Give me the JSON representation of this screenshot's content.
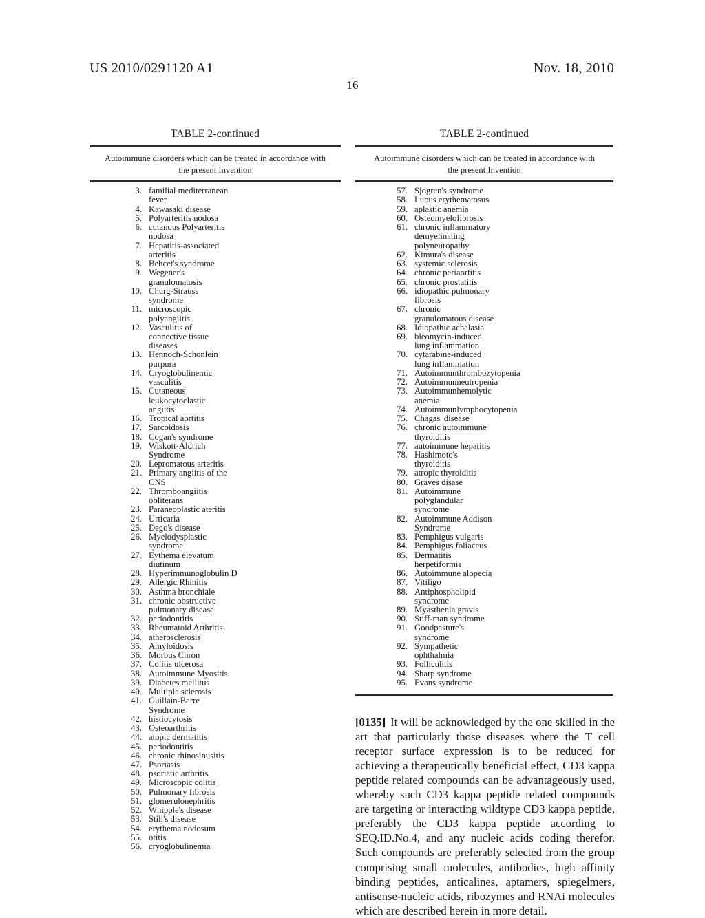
{
  "header": {
    "publication_number": "US 2010/0291120 A1",
    "publication_date": "Nov. 18, 2010",
    "page_number": "16"
  },
  "tables": {
    "left": {
      "caption": "TABLE 2-continued",
      "subhead_line1": "Autoimmune disorders which can be treated in accordance with",
      "subhead_line2": "the present Invention",
      "entries": [
        {
          "num": "3.",
          "lines": [
            "familial mediterranean",
            "fever"
          ]
        },
        {
          "num": "4.",
          "lines": [
            "Kawasaki disease"
          ]
        },
        {
          "num": "5.",
          "lines": [
            "Polyarteritis nodosa"
          ]
        },
        {
          "num": "6.",
          "lines": [
            "cutanous Polyarteritis",
            "nodosa"
          ]
        },
        {
          "num": "7.",
          "lines": [
            "Hepatitis-associated",
            "arteritis"
          ]
        },
        {
          "num": "8.",
          "lines": [
            "Behcet's syndrome"
          ]
        },
        {
          "num": "9.",
          "lines": [
            "Wegener's",
            "granulomatosis"
          ]
        },
        {
          "num": "10.",
          "lines": [
            "Churg-Strauss",
            "syndrome"
          ]
        },
        {
          "num": "11.",
          "lines": [
            "microscopic",
            "polyangiitis"
          ]
        },
        {
          "num": "12.",
          "lines": [
            "Vasculitis of",
            "connective tissue",
            "diseases"
          ]
        },
        {
          "num": "13.",
          "lines": [
            "Hennoch-Schonlein",
            "purpura"
          ]
        },
        {
          "num": "14.",
          "lines": [
            "Cryoglobulinemic",
            "vasculitis"
          ]
        },
        {
          "num": "15.",
          "lines": [
            "Cutaneous",
            "leukocytoclastic",
            "angiitis"
          ]
        },
        {
          "num": "16.",
          "lines": [
            "Tropical aortitis"
          ]
        },
        {
          "num": "17.",
          "lines": [
            "Sarcoidosis"
          ]
        },
        {
          "num": "18.",
          "lines": [
            "Cogan's syndrome"
          ]
        },
        {
          "num": "19.",
          "lines": [
            "Wiskott-Aldrich",
            "Syndrome"
          ]
        },
        {
          "num": "20.",
          "lines": [
            "Lepromatous arteritis"
          ]
        },
        {
          "num": "21.",
          "lines": [
            "Primary angiitis of the",
            "CNS"
          ]
        },
        {
          "num": "22.",
          "lines": [
            "Thromboangiitis",
            "obliterans"
          ]
        },
        {
          "num": "23.",
          "lines": [
            "Paraneoplastic ateritis"
          ]
        },
        {
          "num": "24.",
          "lines": [
            "Urticaria"
          ]
        },
        {
          "num": "25.",
          "lines": [
            "Dego's disease"
          ]
        },
        {
          "num": "26.",
          "lines": [
            "Myelodysplastic",
            "syndrome"
          ]
        },
        {
          "num": "27.",
          "lines": [
            "Eythema elevatum",
            "diutinum"
          ]
        },
        {
          "num": "28.",
          "lines": [
            "Hyperimmunoglobulin D"
          ]
        },
        {
          "num": "29.",
          "lines": [
            "Allergic Rhinitis"
          ]
        },
        {
          "num": "30.",
          "lines": [
            "Asthma bronchiale"
          ]
        },
        {
          "num": "31.",
          "lines": [
            "chronic obstructive",
            "pulmonary disease"
          ]
        },
        {
          "num": "32.",
          "lines": [
            "periodontitis"
          ]
        },
        {
          "num": "33.",
          "lines": [
            "Rheumatoid Arthritis"
          ]
        },
        {
          "num": "34.",
          "lines": [
            "atherosclerosis"
          ]
        },
        {
          "num": "35.",
          "lines": [
            "Amyloidosis"
          ]
        },
        {
          "num": "36.",
          "lines": [
            "Morbus Chron"
          ]
        },
        {
          "num": "37.",
          "lines": [
            "Colitis ulcerosa"
          ]
        },
        {
          "num": "38.",
          "lines": [
            "Autoimmune Myositis"
          ]
        },
        {
          "num": "39.",
          "lines": [
            "Diabetes mellitus"
          ]
        },
        {
          "num": "40.",
          "lines": [
            "Multiple sclerosis"
          ]
        },
        {
          "num": "41.",
          "lines": [
            "Guillain-Barre",
            "Syndrome"
          ]
        },
        {
          "num": "42.",
          "lines": [
            "histiocytosis"
          ]
        },
        {
          "num": "43.",
          "lines": [
            "Osteoarthritis"
          ]
        },
        {
          "num": "44.",
          "lines": [
            "atopic dermatitis"
          ]
        },
        {
          "num": "45.",
          "lines": [
            "periodontitis"
          ]
        },
        {
          "num": "46.",
          "lines": [
            "chronic rhinosinusitis"
          ]
        },
        {
          "num": "47.",
          "lines": [
            "Psoriasis"
          ]
        },
        {
          "num": "48.",
          "lines": [
            "psoriatic arthritis"
          ]
        },
        {
          "num": "49.",
          "lines": [
            "Microscopic colitis"
          ]
        },
        {
          "num": "50.",
          "lines": [
            "Pulmonary fibrosis"
          ]
        },
        {
          "num": "51.",
          "lines": [
            "glomerulonephritis"
          ]
        },
        {
          "num": "52.",
          "lines": [
            "Whipple's disease"
          ]
        },
        {
          "num": "53.",
          "lines": [
            "Still's disease"
          ]
        },
        {
          "num": "54.",
          "lines": [
            "erythema nodosum"
          ]
        },
        {
          "num": "55.",
          "lines": [
            "otitis"
          ]
        },
        {
          "num": "56.",
          "lines": [
            "cryoglobulinemia"
          ]
        }
      ]
    },
    "right": {
      "caption": "TABLE 2-continued",
      "subhead_line1": "Autoimmune disorders which can be treated in accordance with",
      "subhead_line2": "the present Invention",
      "entries": [
        {
          "num": "57.",
          "lines": [
            "Sjogren's syndrome"
          ]
        },
        {
          "num": "58.",
          "lines": [
            "Lupus erythematosus"
          ]
        },
        {
          "num": "59.",
          "lines": [
            "aplastic anemia"
          ]
        },
        {
          "num": "60.",
          "lines": [
            "Osteomyelofibrosis"
          ]
        },
        {
          "num": "61.",
          "lines": [
            "chronic inflammatory",
            "demyelinating",
            "polyneuropathy"
          ]
        },
        {
          "num": "62.",
          "lines": [
            "Kimura's disease"
          ]
        },
        {
          "num": "63.",
          "lines": [
            "systemic sclerosis"
          ]
        },
        {
          "num": "64.",
          "lines": [
            "chronic periaortitis"
          ]
        },
        {
          "num": "65.",
          "lines": [
            "chronic prostatitis"
          ]
        },
        {
          "num": "66.",
          "lines": [
            "idiopathic pulmonary",
            "fibrosis"
          ]
        },
        {
          "num": "67.",
          "lines": [
            "chronic",
            "granulomatous disease"
          ]
        },
        {
          "num": "68.",
          "lines": [
            "Idiopathic achalasia"
          ]
        },
        {
          "num": "69.",
          "lines": [
            "bleomycin-induced",
            "lung inflammation"
          ]
        },
        {
          "num": "70.",
          "lines": [
            "cytarabine-induced",
            "lung inflammation"
          ]
        },
        {
          "num": "71.",
          "lines": [
            "Autoimmunthrombozytopenia"
          ]
        },
        {
          "num": "72.",
          "lines": [
            "Autoimmunneutropenia"
          ]
        },
        {
          "num": "73.",
          "lines": [
            "Autoimmunhemolytic",
            "anemia"
          ]
        },
        {
          "num": "74.",
          "lines": [
            "Autoimmunlymphocytopenia"
          ]
        },
        {
          "num": "75.",
          "lines": [
            "Chagas' disease"
          ]
        },
        {
          "num": "76.",
          "lines": [
            "chronic autoimmune",
            "thyroiditis"
          ]
        },
        {
          "num": "77.",
          "lines": [
            "autoimmune hepatitis"
          ]
        },
        {
          "num": "78.",
          "lines": [
            "Hashimoto's",
            "thyroiditis"
          ]
        },
        {
          "num": "79.",
          "lines": [
            "atropic thyroiditis"
          ]
        },
        {
          "num": "80.",
          "lines": [
            "Graves disase"
          ]
        },
        {
          "num": "81.",
          "lines": [
            "Autoimmune",
            "polyglandular",
            "syndrome"
          ]
        },
        {
          "num": "82.",
          "lines": [
            "Autoimmune Addison",
            "Syndrome"
          ]
        },
        {
          "num": "83.",
          "lines": [
            "Pemphigus vulgaris"
          ]
        },
        {
          "num": "84.",
          "lines": [
            "Pemphigus foliaceus"
          ]
        },
        {
          "num": "85.",
          "lines": [
            "Dermatitis",
            "herpetiformis"
          ]
        },
        {
          "num": "86.",
          "lines": [
            "Autoimmune alopecia"
          ]
        },
        {
          "num": "87.",
          "lines": [
            "Vitiligo"
          ]
        },
        {
          "num": "88.",
          "lines": [
            "Antiphospholipid",
            "syndrome"
          ]
        },
        {
          "num": "89.",
          "lines": [
            "Myasthenia gravis"
          ]
        },
        {
          "num": "90.",
          "lines": [
            "Stiff-man syndrome"
          ]
        },
        {
          "num": "91.",
          "lines": [
            "Goodpasture's",
            "syndrome"
          ]
        },
        {
          "num": "92.",
          "lines": [
            "Sympathetic",
            "ophthalmia"
          ]
        },
        {
          "num": "93.",
          "lines": [
            "Folliculitis"
          ]
        },
        {
          "num": "94.",
          "lines": [
            "Sharp syndrome"
          ]
        },
        {
          "num": "95.",
          "lines": [
            "Evans syndrome"
          ]
        }
      ]
    }
  },
  "paragraph": {
    "number": "[0135]",
    "text": "It will be acknowledged by the one skilled in the art that particularly those diseases where the T cell receptor surface expression is to be reduced for achieving a therapeutically beneficial effect, CD3 kappa peptide related compounds can be advantageously used, whereby such CD3 kappa peptide related compounds are targeting or interacting wildtype CD3 kappa peptide, preferably the CD3 kappa peptide according to SEQ.ID.No.4, and any nucleic acids coding therefor. Such compounds are preferably selected from the group comprising small molecules, antibodies, high affinity binding peptides, anticalines, aptamers, spiegelmers, antisense-nucleic acids, ribozymes and RNAi molecules which are described herein in more detail."
  }
}
